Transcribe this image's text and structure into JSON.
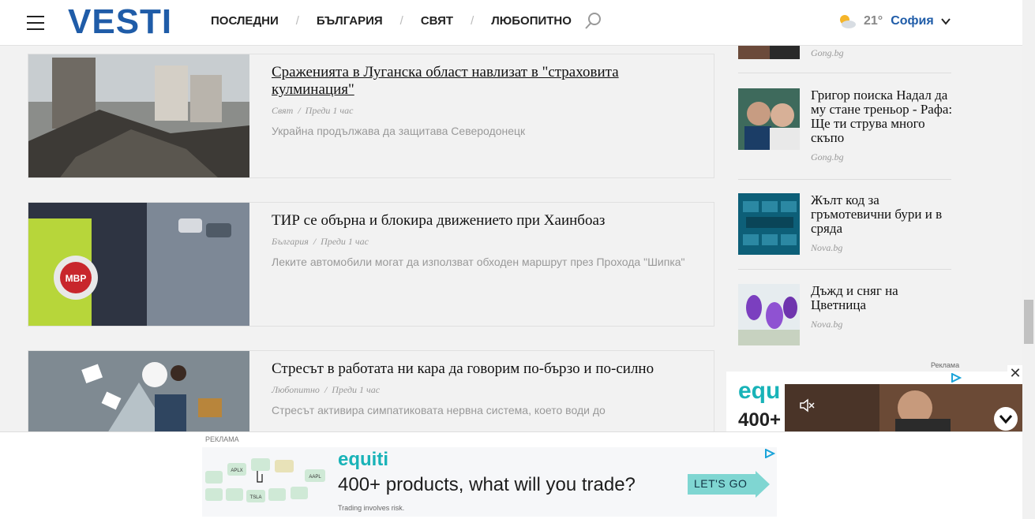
{
  "header": {
    "logo": "VESTI",
    "nav": [
      "ПОСЛЕДНИ",
      "БЪЛГАРИЯ",
      "СВЯТ",
      "ЛЮБОПИТНО"
    ],
    "temperature": "21°",
    "city": "София"
  },
  "articles": [
    {
      "title": "Сраженията в Луганска област навлизат в \"страховита кулминация\"",
      "category": "Свят",
      "time": "Преди 1 час",
      "description": "Украйна продължава да защитава Северодонецк"
    },
    {
      "title": "ТИР се обърна и блокира движението при Хаинбоаз",
      "category": "България",
      "time": "Преди 1 час",
      "description": "Леките автомобили могат да използват обходен маршрут през Прохода \"Шипка\"",
      "thumb_badge": "МВР"
    },
    {
      "title": "Стресът в работата ни кара да говорим по-бързо и по-силно",
      "category": "Любопитно",
      "time": "Преди 1 час",
      "description": "Стресът активира симпатиковата нервна система, което води до"
    }
  ],
  "sidebar": [
    {
      "title": "",
      "source": "Gong.bg"
    },
    {
      "title": "Григор поиска Надал да му стане треньор - Рафа: Ще ти струва много скъпо",
      "source": "Gong.bg"
    },
    {
      "title": "Жълт код за гръмотевични бури и в сряда",
      "source": "Nova.bg"
    },
    {
      "title": "Дъжд и сняг на Цветница",
      "source": "Nova.bg"
    }
  ],
  "side_ad": {
    "label": "Реклама",
    "brand": "equ",
    "products": "400+",
    "close": "✕"
  },
  "bottom_ad": {
    "label": "РЕКЛАМА",
    "brand": "equiti",
    "headline": "400+ products, what will you trade?",
    "cta": "LET'S GO",
    "disclaimer": "Trading involves risk.",
    "tickers": [
      "APLX",
      "AAPL",
      "TSLA"
    ]
  },
  "colors": {
    "brand_blue": "#1f5ca8",
    "equiti_teal": "#19b3b8",
    "cta_teal": "#7fd6d2"
  }
}
